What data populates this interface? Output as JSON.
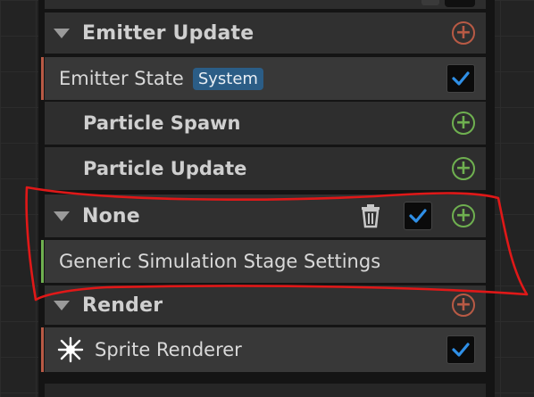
{
  "colors": {
    "accent_orange": "#b85a45",
    "accent_green": "#6fb050",
    "badge_blue": "#2b5d86",
    "check_blue": "#2f8fe6",
    "annotation_red": "#e01818"
  },
  "emitter_update": {
    "label": "Emitter Update",
    "icon": "plus-circle-icon"
  },
  "emitter_state": {
    "label": "Emitter State",
    "badge": "System",
    "checked": true
  },
  "particle_spawn": {
    "label": "Particle Spawn",
    "icon": "plus-circle-icon"
  },
  "particle_update": {
    "label": "Particle Update",
    "icon": "plus-circle-icon"
  },
  "none_stage": {
    "label": "None",
    "icons": [
      "trash-icon",
      "checkbox",
      "plus-circle-icon"
    ],
    "checked": true
  },
  "generic_settings": {
    "label": "Generic Simulation Stage Settings"
  },
  "render": {
    "label": "Render",
    "icon": "plus-circle-icon"
  },
  "sprite_renderer": {
    "label": "Sprite Renderer",
    "icon": "sparkle-icon",
    "checked": true
  }
}
